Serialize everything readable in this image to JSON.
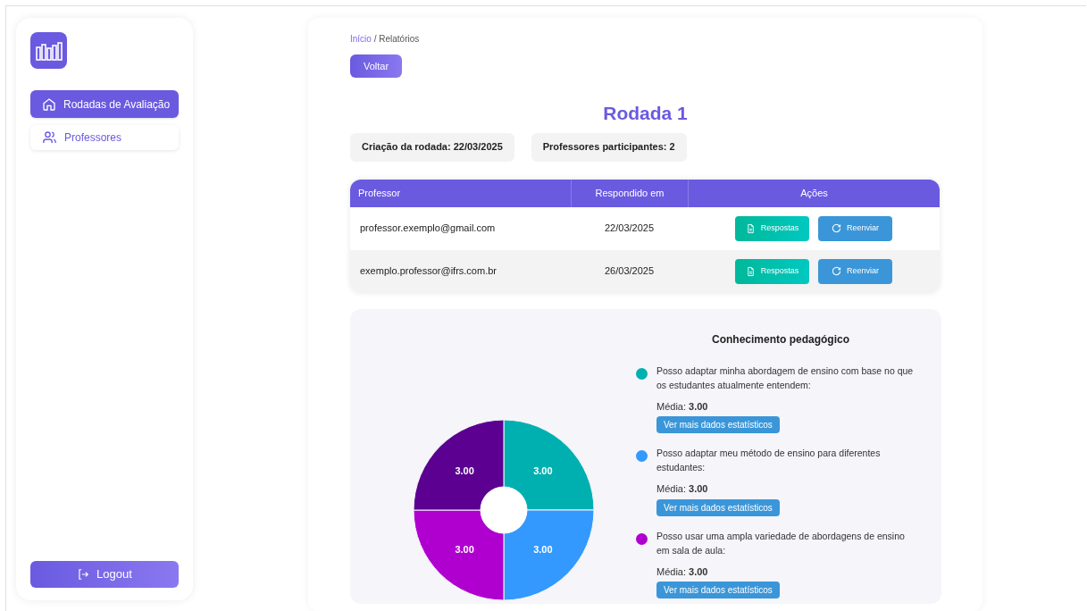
{
  "sidebar": {
    "items": [
      {
        "label": "Rodadas de Avaliação",
        "selected": true
      },
      {
        "label": "Professores",
        "selected": false
      }
    ],
    "logout": "Logout"
  },
  "breadcrumb": {
    "link": "Início",
    "current": "/ Relatórios"
  },
  "back_button": "Voltar",
  "title": "Rodada 1",
  "info_cards": [
    "Criação da rodada: 22/03/2025",
    "Professores participantes: 2"
  ],
  "table": {
    "columns": [
      "Professor",
      "Respondido em",
      "Ações"
    ],
    "rows": [
      {
        "email": "professor.exemplo@gmail.com",
        "date": "22/03/2025",
        "actions": [
          "Respostas",
          "Reenviar"
        ]
      },
      {
        "email": "exemplo.professor@ifrs.com.br",
        "date": "26/03/2025",
        "actions": [
          "Respostas",
          "Reenviar"
        ]
      }
    ]
  },
  "chart_panel": {
    "title": "Conhecimento pedagógico",
    "chart_data": {
      "type": "donut",
      "values": [
        3,
        3,
        3,
        3
      ],
      "colors": [
        "#00b0b0",
        "#3399ff",
        "#b000d0",
        "#5b0090"
      ],
      "value_labels": [
        "3.00",
        "3.00",
        "3.00",
        "3.00"
      ]
    },
    "legend": [
      {
        "text": "Posso adaptar minha abordagem de ensino com base no que os estudantes atualmente entendem:",
        "color": "#00b0b0",
        "mean": "Média: **3.00**",
        "button": "Ver mais dados estatísticos"
      },
      {
        "text": "Posso adaptar meu método de ensino para diferentes estudantes:",
        "color": "#3399ff",
        "mean": "Média: **3.00**",
        "button": "Ver mais dados estatísticos"
      },
      {
        "text": "Posso usar uma ampla variedade de abordagens de ensino em sala de aula:",
        "color": "#b000d0",
        "mean": "Média: **3.00**",
        "button": "Ver mais dados estatísticos"
      }
    ]
  }
}
